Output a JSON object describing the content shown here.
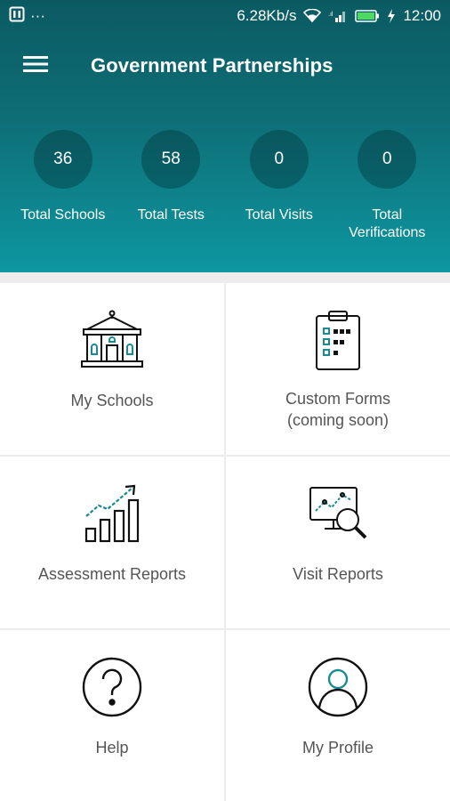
{
  "status_bar": {
    "dots": "···",
    "speed": "6.28Kb/s",
    "time": "12:00"
  },
  "app_bar": {
    "title": "Government Partnerships",
    "menu_icon": "hamburger-menu-icon"
  },
  "stats": [
    {
      "value": "36",
      "label": "Total Schools"
    },
    {
      "value": "58",
      "label": "Total Tests"
    },
    {
      "value": "0",
      "label": "Total Visits"
    },
    {
      "value": "0",
      "label": "Total Verifications"
    }
  ],
  "tiles": [
    {
      "label": "My Schools",
      "icon": "school-building-icon"
    },
    {
      "label": "Custom Forms (coming soon)",
      "icon": "clipboard-checklist-icon"
    },
    {
      "label": "Assessment Reports",
      "icon": "growth-chart-icon"
    },
    {
      "label": "Visit Reports",
      "icon": "analytics-magnifier-icon"
    },
    {
      "label": "Help",
      "icon": "help-question-icon"
    },
    {
      "label": "My Profile",
      "icon": "user-profile-icon"
    }
  ],
  "colors": {
    "header_top": "#0b5a62",
    "header_bottom": "#0d97a1",
    "accent_icon": "#1a8a95",
    "tile_text": "#555555"
  }
}
